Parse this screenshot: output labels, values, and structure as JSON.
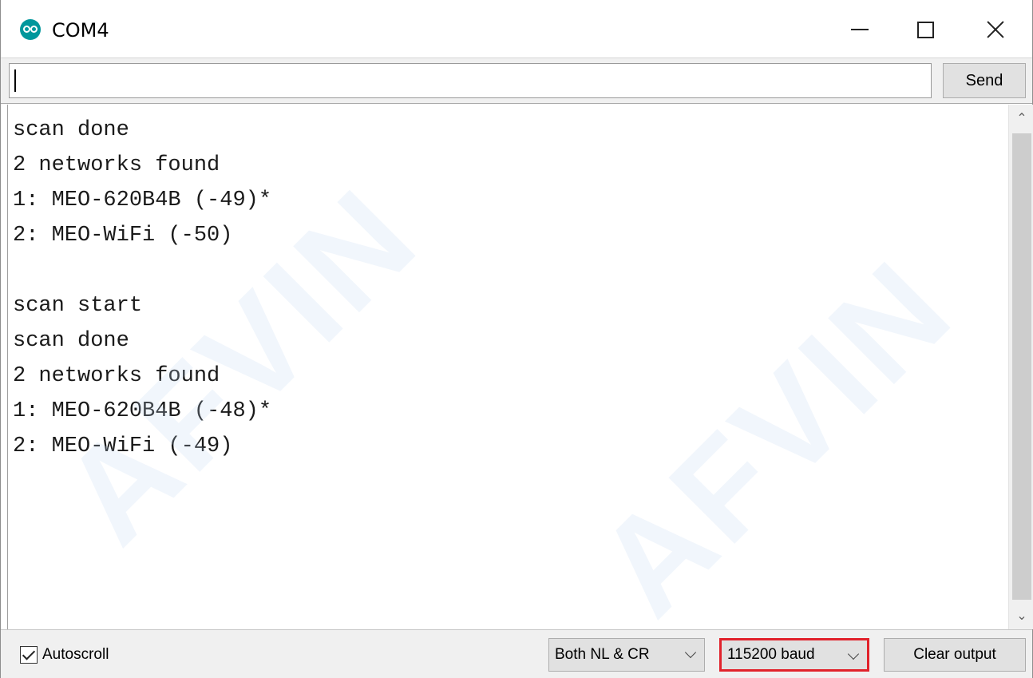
{
  "window": {
    "title": "COM4",
    "app_icon": "arduino-icon",
    "controls": [
      "minimize-icon",
      "maximize-icon",
      "close-icon"
    ]
  },
  "input": {
    "value": "",
    "send_label": "Send"
  },
  "output": {
    "lines": [
      "scan done",
      "2 networks found",
      "1: MEO-620B4B (-49)*",
      "2: MEO-WiFi (-50)",
      "",
      "scan start",
      "scan done",
      "2 networks found",
      "1: MEO-620B4B (-48)*",
      "2: MEO-WiFi (-49)"
    ]
  },
  "watermark": "AFVIN",
  "bottom": {
    "autoscroll_label": "Autoscroll",
    "autoscroll_checked": true,
    "line_ending": "Both NL & CR",
    "baud_rate": "115200 baud",
    "clear_label": "Clear output"
  },
  "colors": {
    "highlight": "#e1222b",
    "arduino_teal": "#00979c"
  }
}
